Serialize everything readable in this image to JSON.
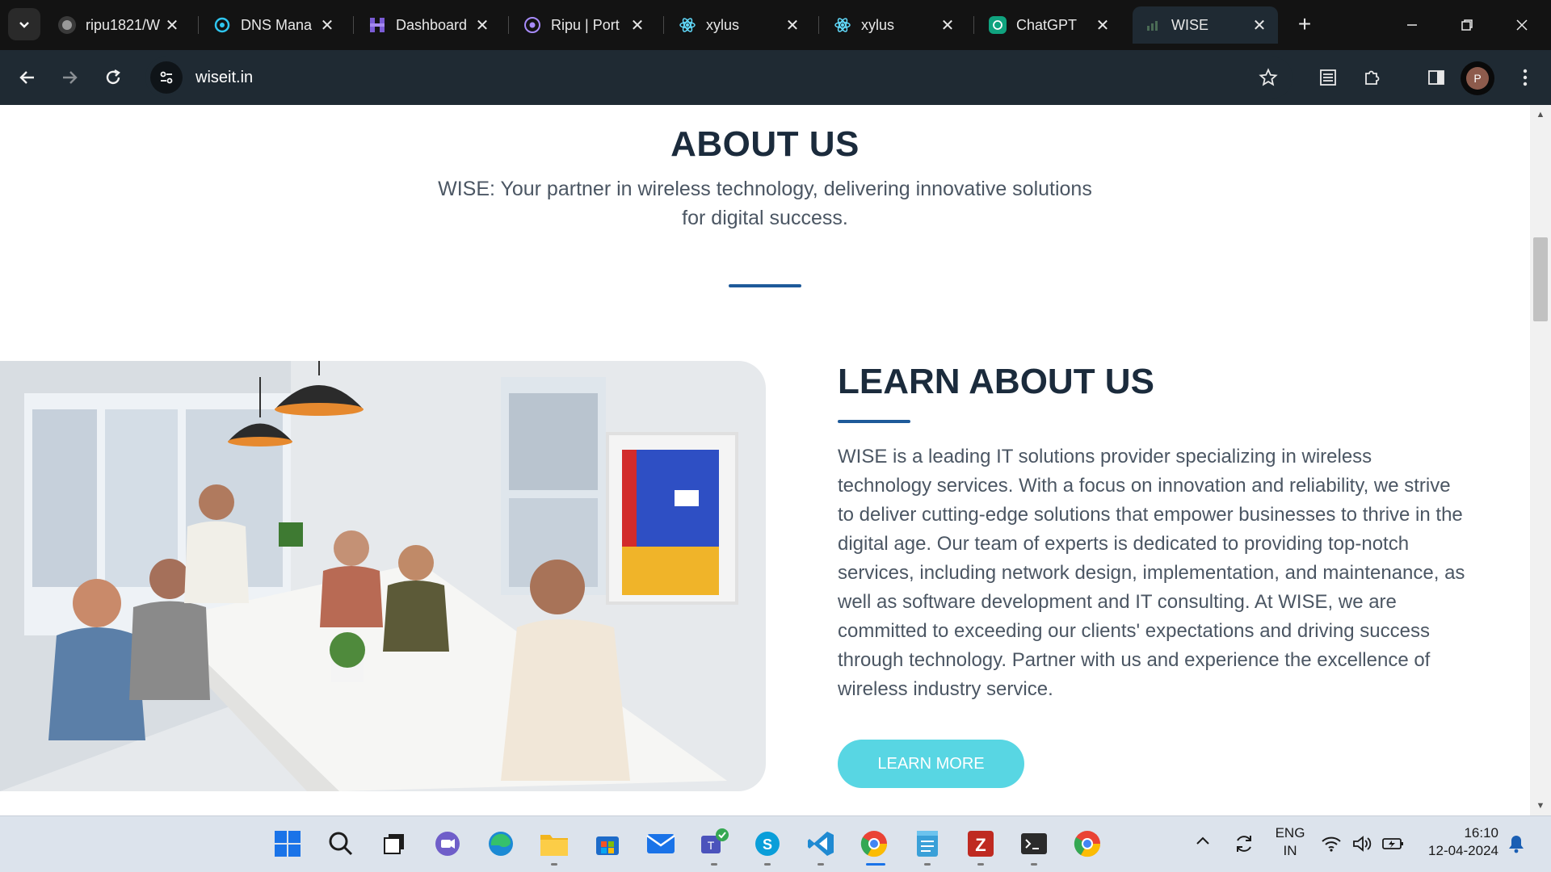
{
  "browser": {
    "tabs": [
      {
        "label": "ripu1821/W",
        "favicon": "github-icon",
        "active": false
      },
      {
        "label": "DNS Mana",
        "favicon": "dns-icon",
        "active": false
      },
      {
        "label": "Dashboard",
        "favicon": "dashboard-icon",
        "active": false
      },
      {
        "label": "Ripu | Port",
        "favicon": "portfolio-icon",
        "active": false
      },
      {
        "label": "xylus",
        "favicon": "react-icon",
        "active": false
      },
      {
        "label": "xylus",
        "favicon": "react-icon",
        "active": false
      },
      {
        "label": "ChatGPT",
        "favicon": "chatgpt-icon",
        "active": false
      },
      {
        "label": "WISE",
        "favicon": "wise-icon",
        "active": true
      }
    ],
    "close_glyph": "✕",
    "new_tab_glyph": "+",
    "address": "wiseit.in",
    "profile_initial": "P"
  },
  "page": {
    "about": {
      "title": "ABOUT US",
      "subtitle": "WISE: Your partner in wireless technology, delivering innovative solutions for digital success."
    },
    "learn": {
      "title": "LEARN ABOUT US",
      "body": "WISE is a leading IT solutions provider specializing in wireless technology services. With a focus on innovation and reliability, we strive to deliver cutting-edge solutions that empower businesses to thrive in the digital age. Our team of experts is dedicated to providing top-notch services, including network design, implementation, and maintenance, as well as software development and IT consulting. At WISE, we are committed to exceeding our clients' expectations and driving success through technology. Partner with us and experience the excellence of wireless industry service.",
      "button": "LEARN MORE"
    },
    "colors": {
      "heading": "#1b2b3c",
      "accent_line": "#1e5a9a",
      "button": "#58d6e3"
    }
  },
  "taskbar": {
    "apps": [
      "windows-start",
      "search",
      "task-view",
      "chat",
      "edge",
      "file-explorer",
      "microsoft-store",
      "mail",
      "teams",
      "skype",
      "vscode",
      "chrome",
      "notepad",
      "filezilla",
      "terminal",
      "chrome"
    ],
    "language_line1": "ENG",
    "language_line2": "IN",
    "time": "16:10",
    "date": "12-04-2024"
  }
}
